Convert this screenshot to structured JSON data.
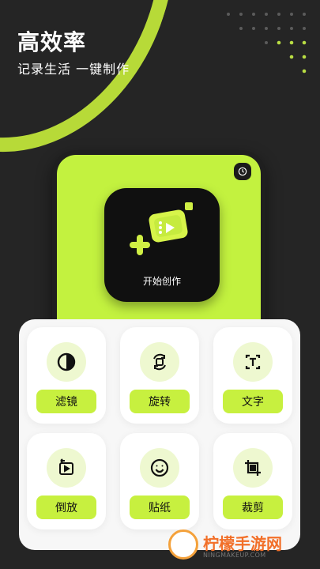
{
  "hero": {
    "title": "高效率",
    "subtitle": "记录生活 一键制作"
  },
  "start": {
    "label": "开始创作"
  },
  "tools": [
    {
      "name": "filter",
      "label": "滤镜",
      "icon": "half-circle-icon"
    },
    {
      "name": "rotate",
      "label": "旋转",
      "icon": "rotate-icon"
    },
    {
      "name": "text",
      "label": "文字",
      "icon": "text-icon"
    },
    {
      "name": "reverse",
      "label": "倒放",
      "icon": "reverse-play-icon"
    },
    {
      "name": "sticker",
      "label": "贴纸",
      "icon": "smiley-icon"
    },
    {
      "name": "crop",
      "label": "裁剪",
      "icon": "crop-icon"
    }
  ],
  "watermark": {
    "title": "柠檬手游网",
    "subtitle": "NINGMAKEUP.COM"
  },
  "colors": {
    "accent": "#c7f03f",
    "background": "#252525"
  }
}
